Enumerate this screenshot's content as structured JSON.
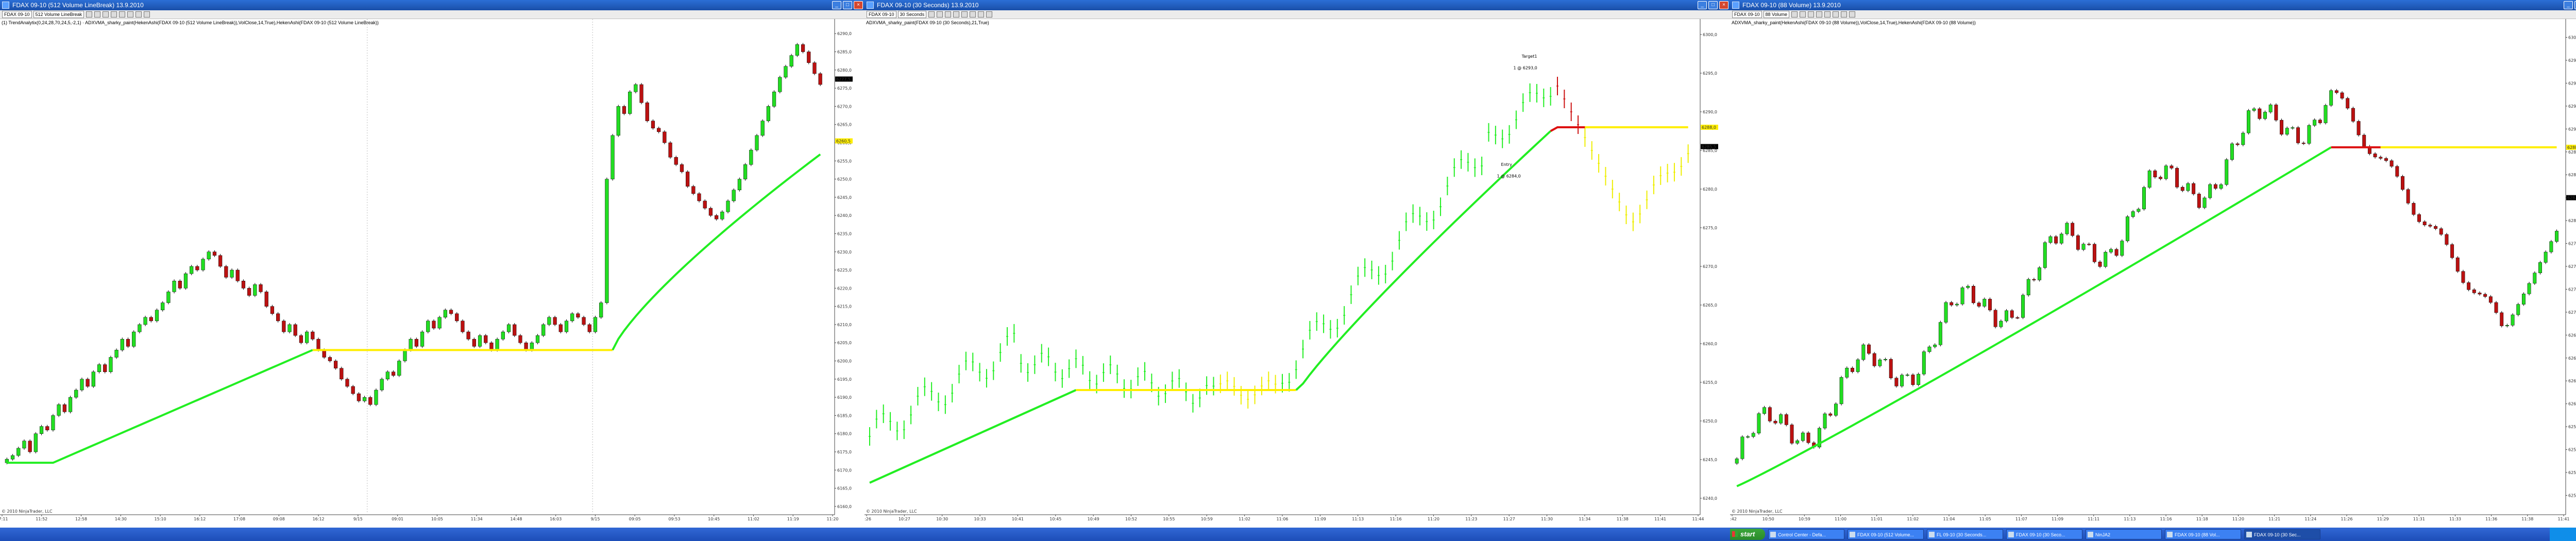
{
  "windows": [
    {
      "title": "FDAX 09-10 (512 Volume LineBreak)  13.9.2010",
      "symbol": "FDAX 09-10",
      "period": "512 Volume LineBreak",
      "indicator_label": "(1) TrendAnalytix(0,24,28,70,24,5,-2,1) · ADXVMA_sharky_paint(HekenAshi(FDAX 09-10 (512 Volume LineBreak)),VolClose,14,True),HekenAshi(FDAX 09-10 (512 Volume LineBreak))",
      "copyright": "© 2010 NinjaTrader, LLC",
      "chart_data": {
        "type": "candlestick",
        "y_ticks": [
          "6290,0",
          "6285,0",
          "6280,0",
          "6275,0",
          "6270,0",
          "6265,0",
          "6260,0",
          "6255,0",
          "6250,0",
          "6245,0",
          "6240,0",
          "6235,0",
          "6230,0",
          "6225,0",
          "6220,0",
          "6215,0",
          "6210,0",
          "6205,0",
          "6200,0",
          "6195,0",
          "6190,0",
          "6185,0",
          "6180,0",
          "6175,0",
          "6170,0",
          "6165,0",
          "6160,0"
        ],
        "y_range": [
          6158,
          6294
        ],
        "x_ticks": [
          "17:11",
          "11:52",
          "12:58",
          "14:30",
          "15:10",
          "16:12",
          "17:08",
          "09:08",
          "16:12",
          "9/15",
          "09:01",
          "10:05",
          "11:34",
          "14:48",
          "16:03",
          "9/15",
          "09:05",
          "09:53",
          "10:45",
          "11:02",
          "11:19",
          "11:20"
        ],
        "closes": [
          6173,
          6174,
          6176,
          6178,
          6175,
          6180,
          6182,
          6181,
          6185,
          6188,
          6186,
          6190,
          6192,
          6195,
          6193,
          6197,
          6199,
          6197,
          6201,
          6203,
          6206,
          6204,
          6208,
          6210,
          6212,
          6211,
          6214,
          6216,
          6219,
          6222,
          6220,
          6224,
          6226,
          6225,
          6228,
          6230,
          6229,
          6226,
          6223,
          6225,
          6222,
          6220,
          6218,
          6221,
          6219,
          6215,
          6213,
          6211,
          6208,
          6210,
          6207,
          6205,
          6208,
          6206,
          6203,
          6201,
          6200,
          6198,
          6195,
          6193,
          6191,
          6189,
          6190,
          6188,
          6192,
          6195,
          6197,
          6196,
          6200,
          6203,
          6206,
          6204,
          6208,
          6211,
          6209,
          6212,
          6214,
          6213,
          6211,
          6208,
          6206,
          6204,
          6207,
          6205,
          6203,
          6206,
          6208,
          6210,
          6207,
          6205,
          6203,
          6205,
          6207,
          6210,
          6212,
          6210,
          6208,
          6211,
          6213,
          6212,
          6210,
          6208,
          6212,
          6216,
          6250,
          6262,
          6270,
          6268,
          6274,
          6276,
          6271,
          6266,
          6264,
          6263,
          6260,
          6256,
          6254,
          6252,
          6248,
          6246,
          6244,
          6242,
          6240,
          6239,
          6241,
          6244,
          6247,
          6250,
          6254,
          6258,
          6262,
          6266,
          6270,
          6274,
          6278,
          6281,
          6284,
          6287,
          6285,
          6282,
          6279,
          6276
        ],
        "ma_start": 6172,
        "ma_end": 6258,
        "ma_flat_level": 6203,
        "last_price": "6277,5",
        "ma_price": "6260,5",
        "ma_colors": {
          "up": "#22ee22",
          "flat": "#ffee00",
          "down": "#dd1111"
        }
      }
    },
    {
      "title": "FDAX 09-10 (30 Seconds)  13.9.2010",
      "symbol": "FDAX 09-10",
      "period": "30 Seconds",
      "indicator_label": "ADXVMA_sharky_paint(FDAX 09-10 (30 Seconds),21,True)",
      "copyright": "© 2010 NinjaTrader, LLC",
      "annotations": {
        "target": "Target1\n1 @ 6293,0",
        "entry": "Entry\n1 @ 6284,0"
      },
      "chart_data": {
        "type": "bar",
        "y_ticks": [
          "6300,0",
          "6295,0",
          "6290,0",
          "6285,0",
          "6280,0",
          "6275,0",
          "6270,0",
          "6265,0",
          "6260,0",
          "6255,0",
          "6250,0",
          "6245,0",
          "6240,0"
        ],
        "y_range": [
          6238,
          6302
        ],
        "x_ticks": [
          "9:26",
          "10:27",
          "10:30",
          "10:33",
          "10:41",
          "10:45",
          "10:49",
          "10:52",
          "10:55",
          "10:59",
          "11:02",
          "11:06",
          "11:09",
          "11:13",
          "11:16",
          "11:20",
          "11:23",
          "11:27",
          "11:30",
          "11:34",
          "11:38",
          "11:41",
          "11:44"
        ],
        "last_price": "6285,5",
        "ma_price": "6288,0"
      }
    },
    {
      "title": "FDAX 09-10 (88 Volume)  13.9.2010",
      "symbol": "FDAX 09-10",
      "period": "88 Volume",
      "indicator_label": "ADXVMA_sharky_paint(HekenAshi(FDAX 09-10 (88 Volume)),VolClose,14,True),HekenAshi(FDAX 09-10 (88 Volume))",
      "copyright": "© 2010 NinjaTrader, LLC",
      "chart_data": {
        "type": "candlestick",
        "y_ticks": [
          "6300,0",
          "6297,5",
          "6295,0",
          "6292,5",
          "6290,0",
          "6287,5",
          "6285,0",
          "6282,5",
          "6280,0",
          "6277,5",
          "6275,0",
          "6272,5",
          "6270,0",
          "6267,5",
          "6265,0",
          "6262,5",
          "6260,0",
          "6257,5",
          "6255,0",
          "6252,5",
          "6250,0"
        ],
        "y_range": [
          6248,
          6302
        ],
        "x_ticks": [
          "9:42",
          "10:50",
          "10:59",
          "11:00",
          "11:01",
          "11:02",
          "11:04",
          "11:05",
          "11:07",
          "11:09",
          "11:11",
          "11:13",
          "11:16",
          "11:18",
          "11:20",
          "11:21",
          "11:24",
          "11:26",
          "11:29",
          "11:31",
          "11:33",
          "11:36",
          "11:38",
          "11:41"
        ],
        "last_price": "6282,5",
        "ma_price": "6288,0"
      }
    }
  ],
  "taskbar": {
    "start_label": "start",
    "items": [
      "Control Center - Defa...",
      "FDAX 09-10 (512 Volume...",
      "FL 09-10 (30 Seconds...",
      "FDAX 09-10 (30 Seco...",
      "NinJA2",
      "FDAX 09-10 (88 Vol...",
      "FDAX 09-10 (30 Sec..."
    ]
  }
}
